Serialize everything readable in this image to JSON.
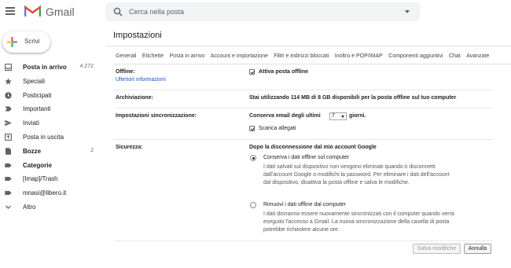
{
  "app": {
    "name": "Gmail"
  },
  "search": {
    "placeholder": "Cerca nella posta"
  },
  "compose": {
    "label": "Scrivi"
  },
  "nav": [
    {
      "label": "Posta in arrivo",
      "count": "4.272",
      "icon": "inbox-icon",
      "bold": true
    },
    {
      "label": "Speciali",
      "count": "",
      "icon": "star-icon",
      "bold": false
    },
    {
      "label": "Posticipati",
      "count": "",
      "icon": "clock-icon",
      "bold": false
    },
    {
      "label": "Importanti",
      "count": "",
      "icon": "important-icon",
      "bold": false
    },
    {
      "label": "Inviati",
      "count": "",
      "icon": "send-icon",
      "bold": false
    },
    {
      "label": "Posta in uscita",
      "count": "",
      "icon": "outbox-icon",
      "bold": false
    },
    {
      "label": "Bozze",
      "count": "2",
      "icon": "draft-icon",
      "bold": true
    },
    {
      "label": "Categorie",
      "count": "",
      "icon": "label-icon",
      "bold": true
    },
    {
      "label": "[Imap]/Trash",
      "count": "",
      "icon": "label-icon",
      "bold": false
    },
    {
      "label": "mnasi@libero.it",
      "count": "",
      "icon": "label-icon",
      "bold": false
    },
    {
      "label": "Altro",
      "count": "",
      "icon": "chevron-down-icon",
      "bold": false
    }
  ],
  "page": {
    "title": "Impostazioni"
  },
  "tabs": [
    "Generali",
    "Etichette",
    "Posta in arrivo",
    "Account e importazione",
    "Filtri e indirizzi bloccati",
    "Inoltro e POP/IMAP",
    "Componenti aggiuntivi",
    "Chat",
    "Avanzate"
  ],
  "offline": {
    "label": "Offline:",
    "link": "Ulteriori informazioni",
    "enable_label": "Attiva posta offline",
    "enabled": true
  },
  "storage": {
    "label": "Archiviazione:",
    "text": "Stai utilizzando 114 MB di 8 GB disponibili per la posta offline sul tuo computer"
  },
  "sync": {
    "label": "Impostazioni sincronizzazione:",
    "prefix": "Conserva email degli ultimi",
    "days": "7",
    "suffix": "giorni.",
    "attachments_label": "Scarica allegati",
    "attachments": true
  },
  "security": {
    "label": "Sicurezza:",
    "heading": "Dopo la disconnessione dal mio account Google",
    "options": [
      {
        "label": "Conserva i dati offline sul computer",
        "selected": true,
        "desc": "I dati salvati sul dispositivo non vengono eliminati quando ti disconnetti dall'account Google o modifichi la password. Per eliminare i dati dell'account dal dispositivo, disattiva la posta offline e salva le modifiche."
      },
      {
        "label": "Rimuovi i dati offline dal computer",
        "selected": false,
        "desc": "I dati dovranno essere nuovamente sincronizzati con il computer quando verrà eseguito l'accesso a Gmail. La nuova sincronizzazione della casella di posta potrebbe richiedere alcune ore."
      }
    ]
  },
  "buttons": {
    "save": "Salva modifiche",
    "cancel": "Annulla"
  },
  "colors": {
    "gmail_red": "#EA4335",
    "link": "#1155cc",
    "google_blue": "#4285F4",
    "google_green": "#34A853",
    "google_yellow": "#FBBC04"
  }
}
